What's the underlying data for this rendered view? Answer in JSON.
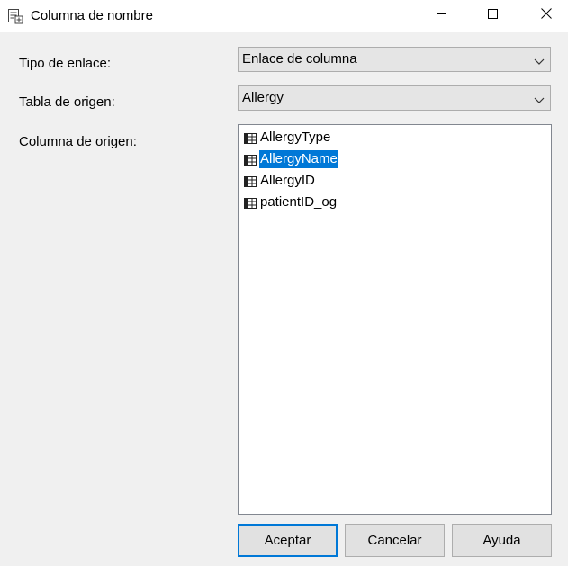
{
  "window": {
    "title": "Columna de nombre",
    "icons": {
      "app": "column-properties-icon",
      "minimize": "minimize-icon",
      "maximize": "maximize-icon",
      "close": "close-icon"
    }
  },
  "form": {
    "link_type_label": "Tipo de enlace:",
    "link_type_value": "Enlace de columna",
    "source_table_label": "Tabla de origen:",
    "source_table_value": "Allergy",
    "source_column_label": "Columna de origen:"
  },
  "columns": {
    "items": [
      "AllergyType",
      "AllergyName",
      "AllergyID",
      "patientID_og"
    ],
    "selected": "AllergyName",
    "item_icon": "column-icon"
  },
  "buttons": {
    "ok": "Aceptar",
    "cancel": "Cancelar",
    "help": "Ayuda"
  },
  "colors": {
    "selection": "#0078d7",
    "default_button_border": "#0078d7",
    "dialog_background": "#f0f0f0"
  }
}
